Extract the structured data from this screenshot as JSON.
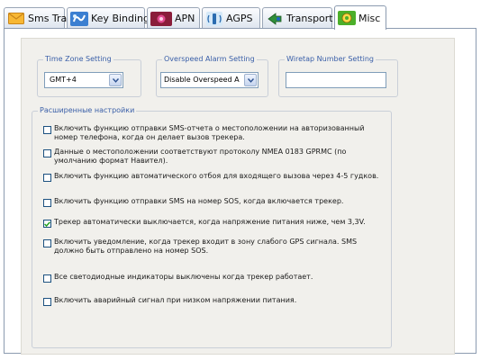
{
  "tabs": [
    {
      "label": "Sms Track",
      "icon": "envelope-icon"
    },
    {
      "label": "Key Binding",
      "icon": "key-binding-icon"
    },
    {
      "label": "APN",
      "icon": "apn-icon"
    },
    {
      "label": "AGPS",
      "icon": "agps-icon"
    },
    {
      "label": "Transport",
      "icon": "transport-icon"
    },
    {
      "label": "Misc",
      "icon": "misc-gear-icon",
      "active": true
    }
  ],
  "settings": {
    "timezone": {
      "label": "Time Zone Setting",
      "value": "GMT+4"
    },
    "overspeed": {
      "label": "Overspeed Alarm Setting",
      "value": "Disable Overspeed A"
    },
    "wiretap": {
      "label": "Wiretap Number Setting",
      "value": ""
    }
  },
  "advanced": {
    "title": "Расширенные настройки",
    "options": [
      {
        "text": "Включить функцию отправки SMS-отчета о местоположении на авторизованный номер телефона, когда он делает вызов трекера.",
        "checked": false
      },
      {
        "text": "Данные о местоположении соответствуют протоколу NMEA 0183 GPRMC (по умолчанию формат Навител).",
        "checked": false
      },
      {
        "text": "Включить функцию автоматического отбоя для входящего вызова через 4-5 гудков.",
        "checked": false
      },
      {
        "text": "Включить функцию отправки SMS на номер SOS, когда включается трекер.",
        "checked": false
      },
      {
        "text": "Трекер автоматически выключается, когда напряжение питания ниже, чем 3,3V.",
        "checked": true
      },
      {
        "text": "Включить уведомление, когда трекер входит в зону слабого GPS сигнала. SMS должно быть отправлено на номер SOS.",
        "checked": false
      },
      {
        "text": "Все светодиодные индикаторы выключены когда трекер работает.",
        "checked": false
      },
      {
        "text": "Включить аварийный сигнал при низком напряжении питания.",
        "checked": false
      }
    ]
  },
  "colors": {
    "group_title": "#3a5fa8",
    "panel_bg": "#f1f0ec",
    "checkmark": "#21a121"
  }
}
